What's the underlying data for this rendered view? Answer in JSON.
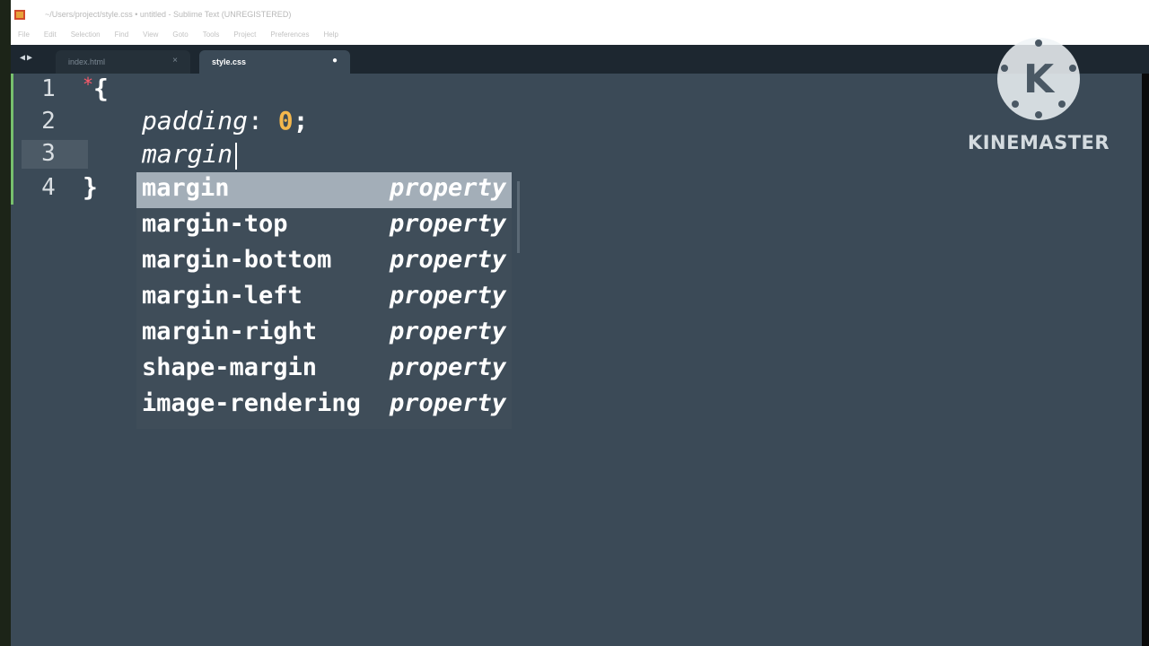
{
  "window": {
    "title": "~/Users/project/style.css • untitled - Sublime Text (UNREGISTERED)"
  },
  "menu": [
    "File",
    "Edit",
    "Selection",
    "Find",
    "View",
    "Goto",
    "Tools",
    "Project",
    "Preferences",
    "Help"
  ],
  "tabs": [
    {
      "label": "index.html",
      "active": false,
      "close": "×"
    },
    {
      "label": "style.css",
      "active": true,
      "close": "●"
    }
  ],
  "editor": {
    "line_numbers": [
      "1",
      "2",
      "3",
      "4"
    ],
    "lines": [
      {
        "selector": "*",
        "brace": "{"
      },
      {
        "property": "padding",
        "separator": ": ",
        "value": "0",
        "terminator": ";"
      },
      {
        "typed": "margin"
      },
      {
        "brace": "}"
      }
    ],
    "current_line": 3
  },
  "autocomplete": {
    "items": [
      {
        "name": "margin",
        "kind": "property",
        "selected": true
      },
      {
        "name": "margin-top",
        "kind": "property",
        "selected": false
      },
      {
        "name": "margin-bottom",
        "kind": "property",
        "selected": false
      },
      {
        "name": "margin-left",
        "kind": "property",
        "selected": false
      },
      {
        "name": "margin-right",
        "kind": "property",
        "selected": false
      },
      {
        "name": "shape-margin",
        "kind": "property",
        "selected": false
      },
      {
        "name": "image-rendering",
        "kind": "property",
        "selected": false
      }
    ]
  },
  "watermark": {
    "text": "KINEMASTER",
    "logo_letter": "K"
  },
  "colors": {
    "editor_bg": "#3b4a57",
    "number_token": "#f4b74c",
    "selection_bg": "#a3aeb8",
    "gutter_modified": "#77c06d"
  }
}
